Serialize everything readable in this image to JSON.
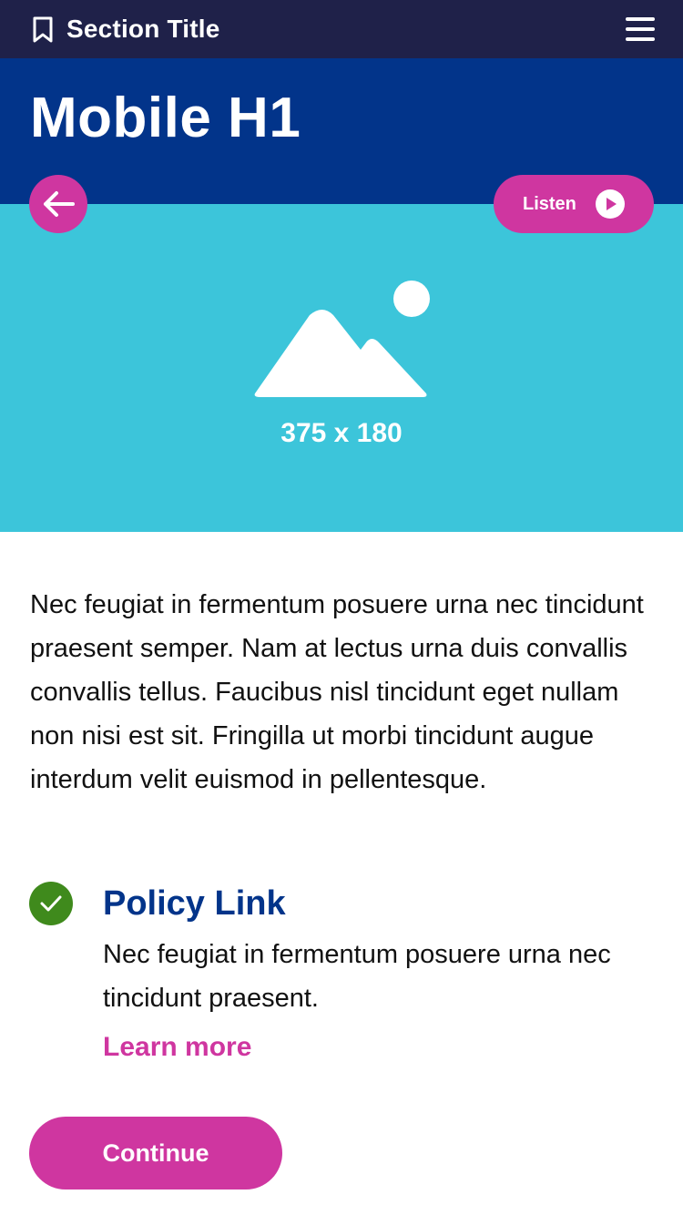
{
  "header": {
    "section_title": "Section Title",
    "icons": {
      "bookmark": "bookmark-icon",
      "menu": "menu-icon"
    }
  },
  "hero": {
    "title": "Mobile H1",
    "image_placeholder_label": "375 x 180",
    "back_icon": "arrow-left-icon",
    "listen_label": "Listen",
    "listen_icon": "play-icon"
  },
  "content": {
    "body": "Nec feugiat in fermentum posuere urna nec tincidunt praesent semper. Nam at lectus urna duis convallis convallis tellus. Faucibus nisl tincidunt eget nullam non nisi est sit. Fringilla ut morbi tincidunt augue interdum velit euismod in pellentesque."
  },
  "policy": {
    "icon": "check-circle-icon",
    "title": "Policy Link",
    "description": "Nec feugiat in fermentum posuere urna nec tincidunt praesent.",
    "link_label": "Learn more"
  },
  "actions": {
    "continue_label": "Continue"
  },
  "colors": {
    "topbar": "#1f2149",
    "header_blue": "#02348a",
    "image_bg": "#3cc5da",
    "accent_pink": "#cf36a0",
    "success_green": "#3f8a1c"
  }
}
